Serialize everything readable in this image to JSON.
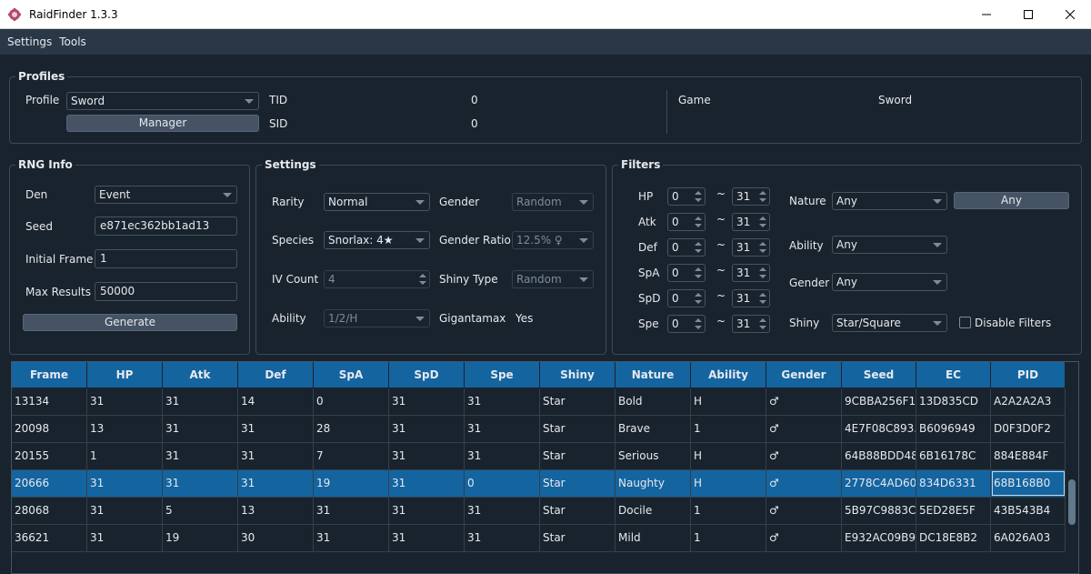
{
  "window": {
    "title": "RaidFinder 1.3.3",
    "controls": [
      "minimize",
      "maximize",
      "close"
    ]
  },
  "menu": {
    "items": [
      "Settings",
      "Tools"
    ]
  },
  "profiles": {
    "title": "Profiles",
    "profile_label": "Profile",
    "profile_value": "Sword",
    "manager_label": "Manager",
    "tid_label": "TID",
    "tid_value": "0",
    "sid_label": "SID",
    "sid_value": "0",
    "game_label": "Game",
    "game_value": "Sword"
  },
  "rng": {
    "title": "RNG Info",
    "den_label": "Den",
    "den_value": "Event",
    "seed_label": "Seed",
    "seed_value": "e871ec362bb1ad13",
    "initial_frame_label": "Initial Frame",
    "initial_frame_value": "1",
    "max_results_label": "Max Results",
    "max_results_value": "50000",
    "generate_label": "Generate"
  },
  "settings": {
    "title": "Settings",
    "rarity_label": "Rarity",
    "rarity_value": "Normal",
    "species_label": "Species",
    "species_value": "Snorlax: 4★",
    "iv_count_label": "IV Count",
    "iv_count_value": "4",
    "ability_label": "Ability",
    "ability_value": "1/2/H",
    "gender_label": "Gender",
    "gender_value": "Random",
    "gender_ratio_label": "Gender Ratio",
    "gender_ratio_value": "12.5% ♀",
    "shiny_type_label": "Shiny Type",
    "shiny_type_value": "Random",
    "gigantamax_label": "Gigantamax",
    "gigantamax_value": "Yes"
  },
  "filters": {
    "title": "Filters",
    "iv_rows": [
      {
        "stat": "HP",
        "min": "0",
        "tilde": "~",
        "max": "31"
      },
      {
        "stat": "Atk",
        "min": "0",
        "tilde": "~",
        "max": "31"
      },
      {
        "stat": "Def",
        "min": "0",
        "tilde": "~",
        "max": "31"
      },
      {
        "stat": "SpA",
        "min": "0",
        "tilde": "~",
        "max": "31"
      },
      {
        "stat": "SpD",
        "min": "0",
        "tilde": "~",
        "max": "31"
      },
      {
        "stat": "Spe",
        "min": "0",
        "tilde": "~",
        "max": "31"
      }
    ],
    "nature_label": "Nature",
    "nature_value": "Any",
    "nature_button": "Any",
    "ability_label": "Ability",
    "ability_value": "Any",
    "gender_label": "Gender",
    "gender_value": "Any",
    "shiny_label": "Shiny",
    "shiny_value": "Star/Square",
    "disable_filters_label": "Disable Filters"
  },
  "table": {
    "headers": [
      "Frame",
      "HP",
      "Atk",
      "Def",
      "SpA",
      "SpD",
      "Spe",
      "Shiny",
      "Nature",
      "Ability",
      "Gender",
      "Seed",
      "EC",
      "PID"
    ],
    "selected_row_index": 3,
    "rows": [
      [
        "13134",
        "31",
        "31",
        "14",
        "0",
        "31",
        "31",
        "Star",
        "Bold",
        "H",
        "♂",
        "9CBBA256F1...",
        "13D835CD",
        "A2A2A2A3"
      ],
      [
        "20098",
        "13",
        "31",
        "31",
        "28",
        "31",
        "31",
        "Star",
        "Brave",
        "1",
        "♂",
        "4E7F08C893...",
        "B6096949",
        "D0F3D0F2"
      ],
      [
        "20155",
        "1",
        "31",
        "31",
        "7",
        "31",
        "31",
        "Star",
        "Serious",
        "H",
        "♂",
        "64B88BDD48...",
        "6B16178C",
        "884E884F"
      ],
      [
        "20666",
        "31",
        "31",
        "31",
        "19",
        "31",
        "0",
        "Star",
        "Naughty",
        "H",
        "♂",
        "2778C4AD60...",
        "834D6331",
        "68B168B0"
      ],
      [
        "28068",
        "31",
        "5",
        "13",
        "31",
        "31",
        "31",
        "Star",
        "Docile",
        "1",
        "♂",
        "5B97C9883C...",
        "5ED28E5F",
        "43B543B4"
      ],
      [
        "36621",
        "31",
        "19",
        "30",
        "31",
        "31",
        "31",
        "Star",
        "Mild",
        "1",
        "♂",
        "E932AC09B9...",
        "DC18E8B2",
        "6A026A03"
      ]
    ]
  }
}
